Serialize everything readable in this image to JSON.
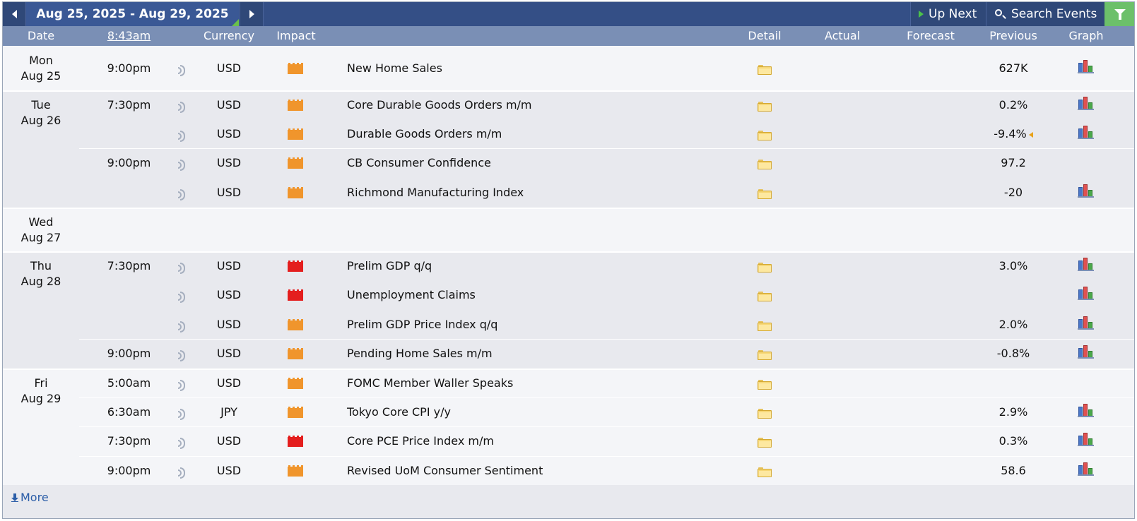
{
  "toolbar": {
    "date_range": "Aug 25, 2025 - Aug 29, 2025",
    "up_next": "Up Next",
    "search_events": "Search Events"
  },
  "headers": {
    "date": "Date",
    "time": "8:43am",
    "currency": "Currency",
    "impact": "Impact",
    "detail": "Detail",
    "actual": "Actual",
    "forecast": "Forecast",
    "previous": "Previous",
    "graph": "Graph"
  },
  "colors": {
    "impact_medium": "#f0952c",
    "impact_high": "#e41e1e",
    "toolbar_bg": "#344f86",
    "header_bg": "#7a8fb5",
    "filter_bg": "#6cc06a"
  },
  "days": [
    {
      "day": "Mon",
      "date": "Aug 25"
    },
    {
      "day": "Tue",
      "date": "Aug 26"
    },
    {
      "day": "Wed",
      "date": "Aug 27"
    },
    {
      "day": "Thu",
      "date": "Aug 28"
    },
    {
      "day": "Fri",
      "date": "Aug 29"
    }
  ],
  "events": [
    {
      "time": "9:00pm",
      "currency": "USD",
      "impact": "medium",
      "event": "New Home Sales",
      "previous": "627K",
      "graph": true
    },
    {
      "time": "7:30pm",
      "currency": "USD",
      "impact": "medium",
      "event": "Core Durable Goods Orders m/m",
      "previous": "0.2%",
      "graph": true
    },
    {
      "time": "",
      "currency": "USD",
      "impact": "medium",
      "event": "Durable Goods Orders m/m",
      "previous": "-9.4%",
      "revised": true,
      "graph": true
    },
    {
      "time": "9:00pm",
      "currency": "USD",
      "impact": "medium",
      "event": "CB Consumer Confidence",
      "previous": "97.2",
      "graph": false
    },
    {
      "time": "",
      "currency": "USD",
      "impact": "medium",
      "event": "Richmond Manufacturing Index",
      "previous": "-20",
      "graph": true
    },
    {
      "time": "7:30pm",
      "currency": "USD",
      "impact": "high",
      "event": "Prelim GDP q/q",
      "previous": "3.0%",
      "graph": true
    },
    {
      "time": "",
      "currency": "USD",
      "impact": "high",
      "event": "Unemployment Claims",
      "previous": "",
      "graph": true
    },
    {
      "time": "",
      "currency": "USD",
      "impact": "medium",
      "event": "Prelim GDP Price Index q/q",
      "previous": "2.0%",
      "graph": true
    },
    {
      "time": "9:00pm",
      "currency": "USD",
      "impact": "medium",
      "event": "Pending Home Sales m/m",
      "previous": "-0.8%",
      "graph": true
    },
    {
      "time": "5:00am",
      "currency": "USD",
      "impact": "medium",
      "event": "FOMC Member Waller Speaks",
      "previous": "",
      "graph": false
    },
    {
      "time": "6:30am",
      "currency": "JPY",
      "impact": "medium",
      "event": "Tokyo Core CPI y/y",
      "previous": "2.9%",
      "graph": true
    },
    {
      "time": "7:30pm",
      "currency": "USD",
      "impact": "high",
      "event": "Core PCE Price Index m/m",
      "previous": "0.3%",
      "graph": true
    },
    {
      "time": "9:00pm",
      "currency": "USD",
      "impact": "medium",
      "event": "Revised UoM Consumer Sentiment",
      "previous": "58.6",
      "graph": true
    }
  ],
  "more_label": "More"
}
